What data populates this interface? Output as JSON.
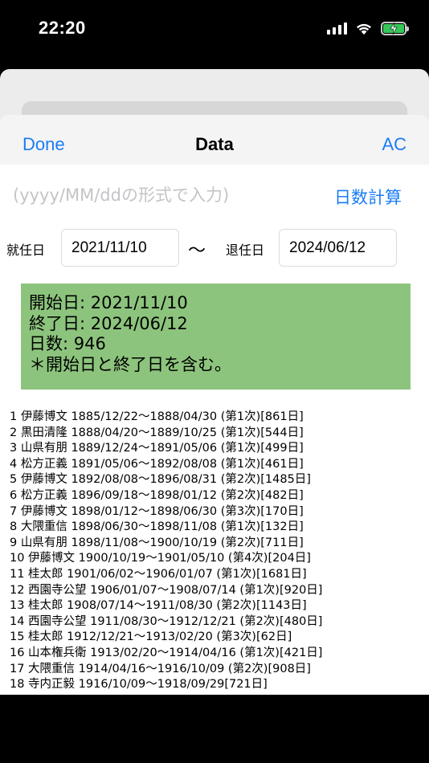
{
  "status_bar": {
    "time": "22:20",
    "icons": [
      "signal-icon",
      "wifi-icon",
      "battery-charging-icon"
    ],
    "battery_color": "#34c759"
  },
  "nav": {
    "done_label": "Done",
    "title": "Data",
    "ac_label": "AC"
  },
  "input": {
    "placeholder": "(yyyy/MM/ddの形式で入力)",
    "calc_label": "日数計算"
  },
  "dates": {
    "start_label": "就任日",
    "start_value": "2021/11/10",
    "separator": "〜",
    "end_label": "退任日",
    "end_value": "2024/06/12"
  },
  "result": {
    "lines": [
      "開始日: 2021/11/10",
      "終了日: 2024/06/12",
      "日数: 946",
      "＊開始日と終了日を含む。"
    ],
    "background": "#8dc47d"
  },
  "list": [
    "1 伊藤博文 1885/12/22〜1888/04/30 (第1次)[861日]",
    "2 黒田清隆 1888/04/20〜1889/10/25 (第1次)[544日]",
    "3 山県有朋 1889/12/24〜1891/05/06 (第1次)[499日]",
    "4 松方正義 1891/05/06〜1892/08/08 (第1次)[461日]",
    "5 伊藤博文 1892/08/08〜1896/08/31 (第2次)[1485日]",
    "6 松方正義 1896/09/18〜1898/01/12 (第2次)[482日]",
    "7 伊藤博文 1898/01/12〜1898/06/30 (第3次)[170日]",
    "8 大隈重信 1898/06/30〜1898/11/08 (第1次)[132日]",
    "9 山県有朋 1898/11/08〜1900/10/19 (第2次)[711日]",
    "10 伊藤博文 1900/10/19〜1901/05/10 (第4次)[204日]",
    "11 桂太郎 1901/06/02〜1906/01/07 (第1次)[1681日]",
    "12 西園寺公望 1906/01/07〜1908/07/14 (第1次)[920日]",
    "13 桂太郎 1908/07/14〜1911/08/30 (第2次)[1143日]",
    "14 西園寺公望 1911/08/30〜1912/12/21 (第2次)[480日]",
    "15 桂太郎 1912/12/21〜1913/02/20 (第3次)[62日]",
    "16 山本権兵衛 1913/02/20〜1914/04/16 (第1次)[421日]",
    "17 大隈重信 1914/04/16〜1916/10/09 (第2次)[908日]",
    "18 寺内正毅 1916/10/09〜1918/09/29[721日]"
  ],
  "colors": {
    "accent": "#1a7cf5"
  }
}
